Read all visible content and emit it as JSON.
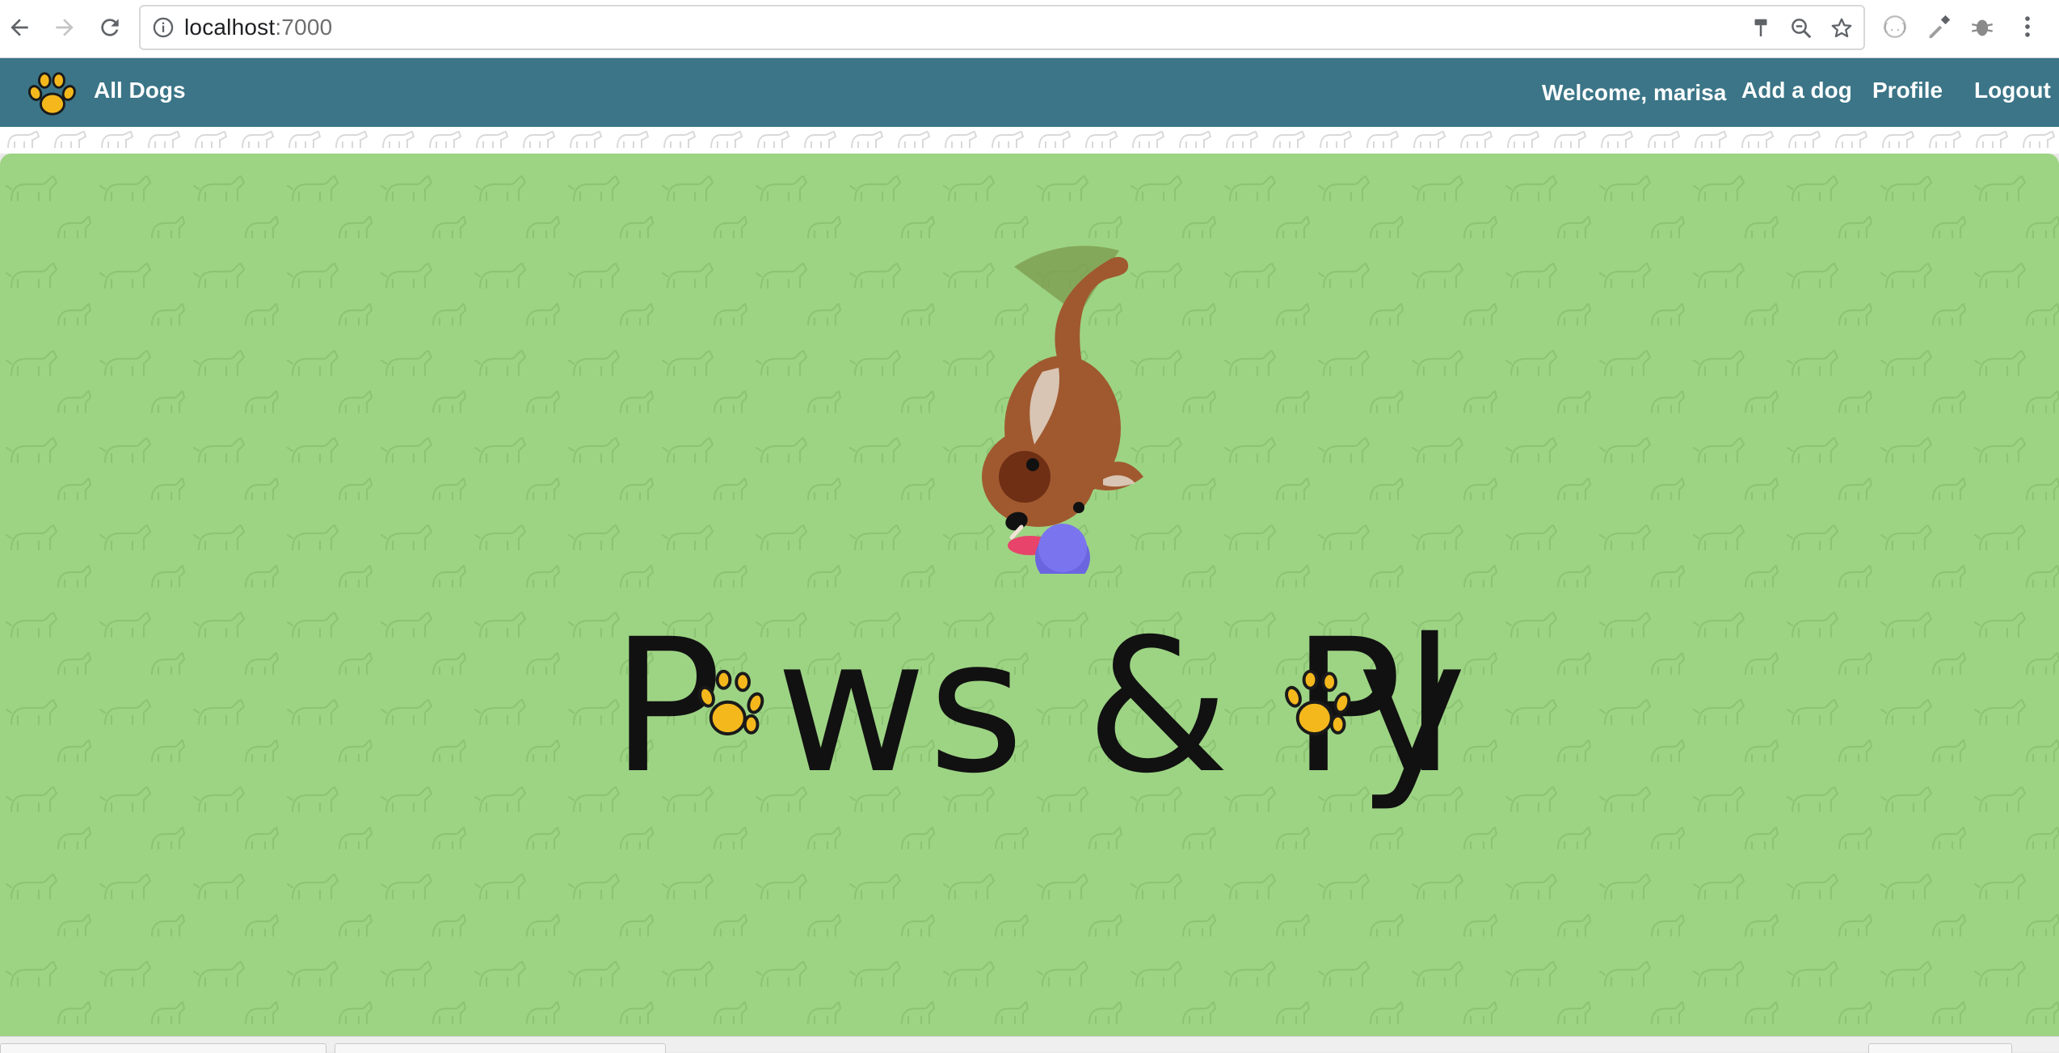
{
  "browser": {
    "url_host": "localhost",
    "url_port": ":7000"
  },
  "navbar": {
    "brand": "All Dogs",
    "welcome": "Welcome, marisa",
    "links": [
      "Add a dog",
      "Profile",
      "Logout"
    ]
  },
  "hero": {
    "title_parts": [
      "P",
      "ws & Pl",
      "y"
    ],
    "title_alt": "Paws & Play"
  },
  "icons": {
    "back": "back-arrow-icon",
    "forward": "forward-arrow-icon",
    "reload": "reload-icon",
    "info": "info-icon",
    "brand": "paw-icon"
  },
  "colors": {
    "navbar": "#3b7587",
    "hero": "#9dd484",
    "paw": "#f5b81c",
    "dog_fur": "#a0592f",
    "ball": "#6b66e0"
  }
}
